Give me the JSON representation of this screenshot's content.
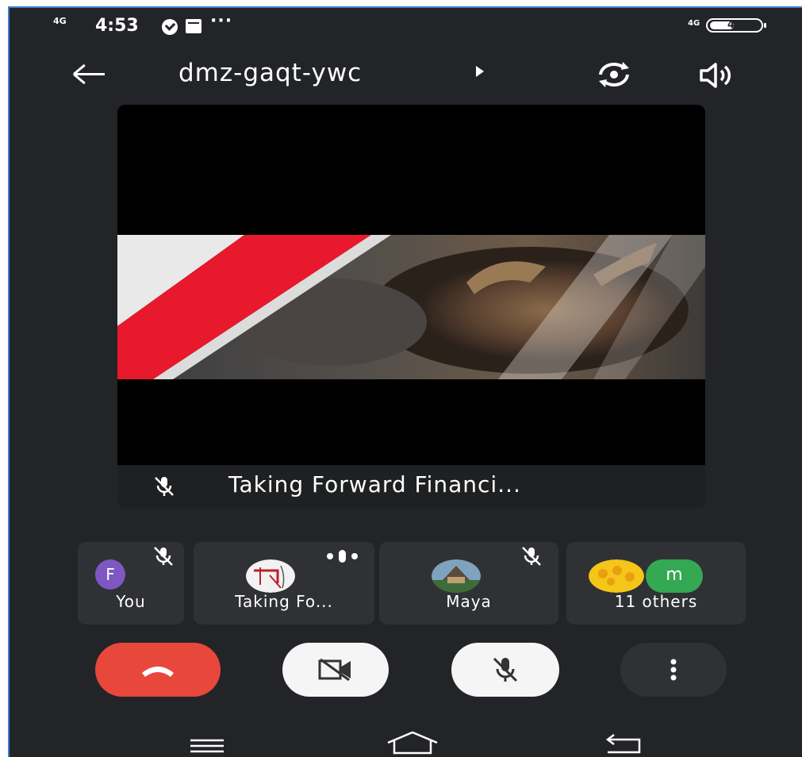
{
  "status_bar": {
    "signal_label": "4G",
    "time": "4:53",
    "more_indicator": "···",
    "network_label": "4G",
    "battery_level": "49",
    "icons": [
      "signal-icon",
      "check-circle-icon",
      "calendar-icon",
      "wifi-icon",
      "battery-icon"
    ]
  },
  "header": {
    "meeting_code": "dmz-gaqt-ywc",
    "icons": [
      "back-arrow-icon",
      "caret-right-icon",
      "switch-camera-icon",
      "speaker-icon"
    ]
  },
  "main_tile": {
    "presenter_name": "Taking Forward Financi...",
    "presenter_muted": true,
    "content": "presentation with bull statue image and red stripe"
  },
  "participants": [
    {
      "label": "You",
      "avatar_letter": "F",
      "avatar_color": "#7e57c2",
      "muted": true
    },
    {
      "label": "Taking Fo...",
      "avatar_type": "image",
      "speaking": true
    },
    {
      "label": "Maya",
      "avatar_type": "image",
      "muted": true
    },
    {
      "label": "11 others",
      "avatar_letter": "m",
      "avatar_color": "#34a853"
    }
  ],
  "controls": {
    "end_call_color": "#e8473b",
    "icons": [
      "end-call-icon",
      "camera-off-icon",
      "mic-off-icon",
      "more-vert-icon"
    ]
  },
  "nav": {
    "icons": [
      "menu-icon",
      "home-icon",
      "back-icon"
    ]
  },
  "colors": {
    "background": "#232427",
    "tile": "#303134",
    "accent_red": "#e8473b",
    "avatar_purple": "#7e57c2",
    "avatar_green": "#34a853"
  }
}
